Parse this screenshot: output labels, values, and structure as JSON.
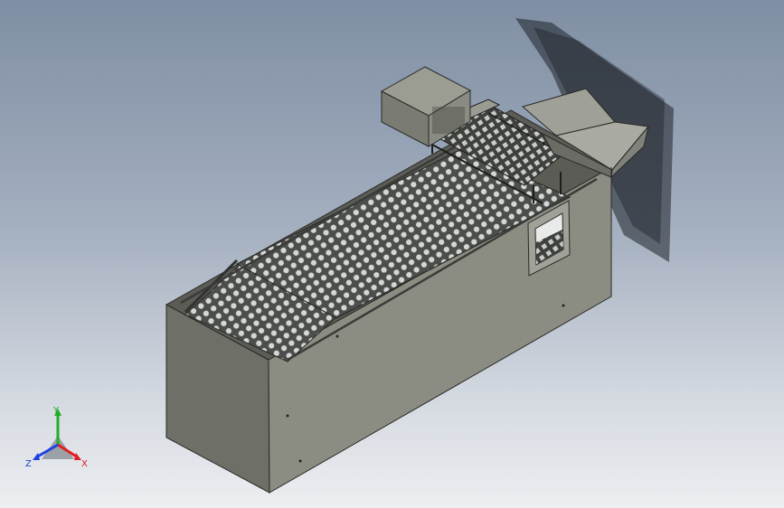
{
  "view": {
    "background_top": "#7f8ea4",
    "background_bottom": "#eceef1",
    "model_body_color": "#7d7d72",
    "model_side_color": "#8e8f84",
    "mesh_color": "#cfd2d0"
  },
  "triad": {
    "x_label": "X",
    "y_label": "Y",
    "z_label": "Z",
    "x_color": "#e02020",
    "y_color": "#20b020",
    "z_color": "#2040e0"
  }
}
